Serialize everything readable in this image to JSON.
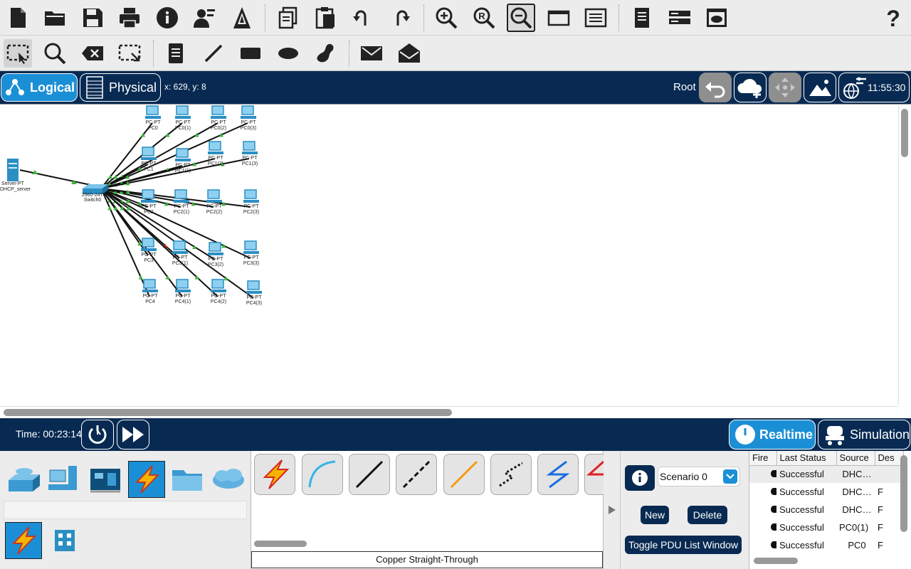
{
  "toolbar_main": {
    "icons": [
      "new-file-icon",
      "open-folder-icon",
      "save-icon",
      "print-icon",
      "info-icon",
      "user-profile-icon",
      "activity-wizard-icon",
      "copy-icon",
      "paste-icon",
      "undo-icon",
      "redo-icon",
      "zoom-in-icon",
      "zoom-reset-icon",
      "zoom-out-icon",
      "drawing-palette-icon",
      "custom-device-dialog-icon",
      "viewport-icon",
      "server-cluster-icon",
      "cloud-window-icon",
      "help-icon"
    ]
  },
  "toolbar_tools": {
    "icons": [
      "select-tool-icon",
      "inspect-tool-icon",
      "delete-tool-icon",
      "resize-tool-icon",
      "note-tool-icon",
      "line-tool-icon",
      "rectangle-tool-icon",
      "ellipse-tool-icon",
      "freeform-tool-icon",
      "simple-pdu-icon",
      "complex-pdu-icon"
    ]
  },
  "workspace_bar": {
    "logical_label": "Logical",
    "physical_label": "Physical",
    "coords": "x: 629, y: 8",
    "root_label": "Root",
    "clock": "11:55:30"
  },
  "topology": {
    "server": {
      "type_label": "Server-PT",
      "name": "DHCP_server"
    },
    "switch": {
      "type_label": "2960-24TT",
      "name": "Switch0"
    },
    "pcs": [
      {
        "type": "PC-PT",
        "name": "PC0"
      },
      {
        "type": "PC-PT",
        "name": "PC0(1)"
      },
      {
        "type": "PC-PT",
        "name": "PC0(2)"
      },
      {
        "type": "PC-PT",
        "name": "PC0(3)"
      },
      {
        "type": "PC-PT",
        "name": "PC1"
      },
      {
        "type": "PC-PT",
        "name": "PC1(1)"
      },
      {
        "type": "PC-PT",
        "name": "PC1(2)"
      },
      {
        "type": "PC-PT",
        "name": "PC1(3)"
      },
      {
        "type": "PC-PT",
        "name": "PC2"
      },
      {
        "type": "PC-PT",
        "name": "PC2(1)"
      },
      {
        "type": "PC-PT",
        "name": "PC2(2)"
      },
      {
        "type": "PC-PT",
        "name": "PC2(3)"
      },
      {
        "type": "PC-PT",
        "name": "PC3"
      },
      {
        "type": "PC-PT",
        "name": "PC3(1)"
      },
      {
        "type": "PC-PT",
        "name": "PC3(2)"
      },
      {
        "type": "PC-PT",
        "name": "PC3(3)"
      },
      {
        "type": "PC-PT",
        "name": "PC4"
      },
      {
        "type": "PC-PT",
        "name": "PC4(1)"
      },
      {
        "type": "PC-PT",
        "name": "PC4(2)"
      },
      {
        "type": "PC-PT",
        "name": "PC4(3)"
      }
    ],
    "colors": {
      "link": "#111111",
      "link_up": "#3cb43c",
      "link_down": "#e02020",
      "device": "#2b8fc4"
    }
  },
  "status_bar": {
    "time_label": "Time: 00:23:14",
    "realtime_label": "Realtime",
    "simulation_label": "Simulation"
  },
  "device_panel": {
    "categories": [
      "network-devices-icon",
      "end-devices-icon",
      "components-icon",
      "connections-icon",
      "miscellaneous-icon",
      "multiuser-icon"
    ],
    "selected_category": "connections-icon"
  },
  "connection_panel": {
    "types": [
      "automatic-connection",
      "console",
      "copper-straight-through",
      "copper-cross-over",
      "fiber",
      "phone",
      "coaxial",
      "serial-dce"
    ],
    "selected_description": "Copper Straight-Through"
  },
  "scenario": {
    "name": "Scenario 0",
    "new_label": "New",
    "delete_label": "Delete",
    "toggle_label": "Toggle PDU List Window"
  },
  "pdu_list": {
    "headers": [
      "Fire",
      "Last Status",
      "Source",
      "Des"
    ],
    "rows": [
      {
        "status": "Successful",
        "source": "DHC…",
        "dest": ""
      },
      {
        "status": "Successful",
        "source": "DHC…",
        "dest": "F"
      },
      {
        "status": "Successful",
        "source": "DHC…",
        "dest": "F"
      },
      {
        "status": "Successful",
        "source": "PC0(1)",
        "dest": "F"
      },
      {
        "status": "Successful",
        "source": "PC0",
        "dest": "F"
      }
    ]
  },
  "colors": {
    "navy": "#082a52",
    "accent_blue": "#1b8fd6",
    "toolbar_bg": "#ececec"
  }
}
